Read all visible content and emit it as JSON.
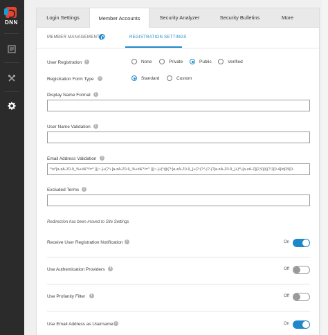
{
  "brand": {
    "logo_text": "DNN"
  },
  "rail": {
    "icons": [
      "document-icon",
      "tools-icon",
      "gear-icon"
    ],
    "active": "gear-icon"
  },
  "tabs": [
    {
      "label": "Login Settings",
      "active": false
    },
    {
      "label": "Member Accounts",
      "active": true
    },
    {
      "label": "Security Analyzer",
      "active": false
    },
    {
      "label": "Security Bulletins",
      "active": false
    },
    {
      "label": "More",
      "active": false
    }
  ],
  "subtabs": {
    "member_management": "MEMBER MANAGEMENT",
    "registration_settings": "REGISTRATION SETTINGS"
  },
  "form": {
    "user_registration": {
      "label": "User Registration",
      "options": [
        "None",
        "Private",
        "Public",
        "Verified"
      ],
      "selected": "Public"
    },
    "registration_form_type": {
      "label": "Registration Form Type",
      "options": [
        "Standard",
        "Custom"
      ],
      "selected": "Standard"
    },
    "display_name_format": {
      "label": "Display Name Format",
      "value": ""
    },
    "user_name_validation": {
      "label": "User Name Validation",
      "value": ""
    },
    "email_address_validation": {
      "label": "Email Address Validation",
      "value": "^\\s*[a-zA-Z0-9_%+#&'*/=^`{|}~-]+(?:\\.[a-zA-Z0-9_%+#&'*/=^`{|}~-]+)*@(?:[a-zA-Z0-9_]+(?:(?:\\.|?-)?[a-zA-Z0-9_]+)*\\.[a-zA-Z]{2,9}|\\[(?:2[0-4]\\d|25[0-"
    },
    "excluded_terms": {
      "label": "Excluded Terms",
      "value": ""
    },
    "redirection_note": "Redirection has been moved to Site Settings",
    "switches": [
      {
        "label": "Receive User Registration Notification",
        "state": "On",
        "on": true
      },
      {
        "label": "Use Authentication Providers",
        "state": "Off",
        "on": false
      },
      {
        "label": "Use Profanity Filter",
        "state": "Off",
        "on": false
      },
      {
        "label": "Use Email Address as Username",
        "state": "On",
        "on": true
      }
    ]
  },
  "colors": {
    "accent": "#1e88c8",
    "rail_bg": "#2b2b2b",
    "logo_red": "#e8432e",
    "logo_blue": "#1b9ad6"
  }
}
